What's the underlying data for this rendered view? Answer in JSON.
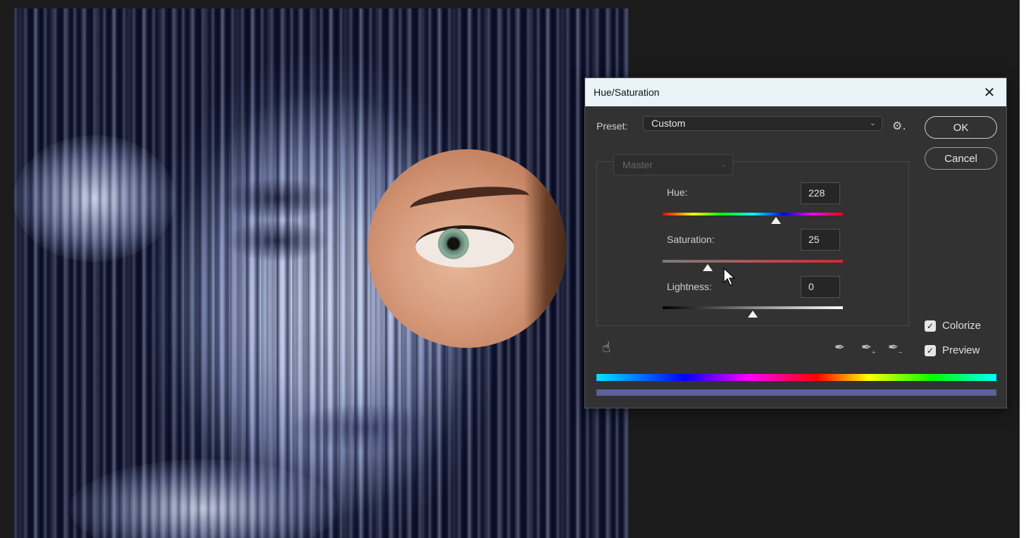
{
  "dialog": {
    "title": "Hue/Saturation",
    "close_glyph": "✕",
    "preset": {
      "label": "Preset:",
      "value": "Custom"
    },
    "channel": {
      "value": "Master"
    },
    "buttons": {
      "ok": "OK",
      "cancel": "Cancel"
    },
    "sliders": [
      {
        "label": "Hue:",
        "value": "228",
        "position_fraction": 0.63
      },
      {
        "label": "Saturation:",
        "value": "25",
        "position_fraction": 0.25
      },
      {
        "label": "Lightness:",
        "value": "0",
        "position_fraction": 0.5
      }
    ],
    "checkboxes": [
      {
        "label": "Colorize",
        "checked": true
      },
      {
        "label": "Preview",
        "checked": true
      }
    ],
    "icons": {
      "gear": "gear-icon",
      "hand": "targeted-adjustment-icon",
      "eyedroppers": [
        "eyedropper-icon",
        "eyedropper-add-icon",
        "eyedropper-subtract-icon"
      ]
    },
    "colors": {
      "result_bar": "#5a6298",
      "titlebar": "#eaf3f7",
      "panel": "#323232"
    }
  }
}
